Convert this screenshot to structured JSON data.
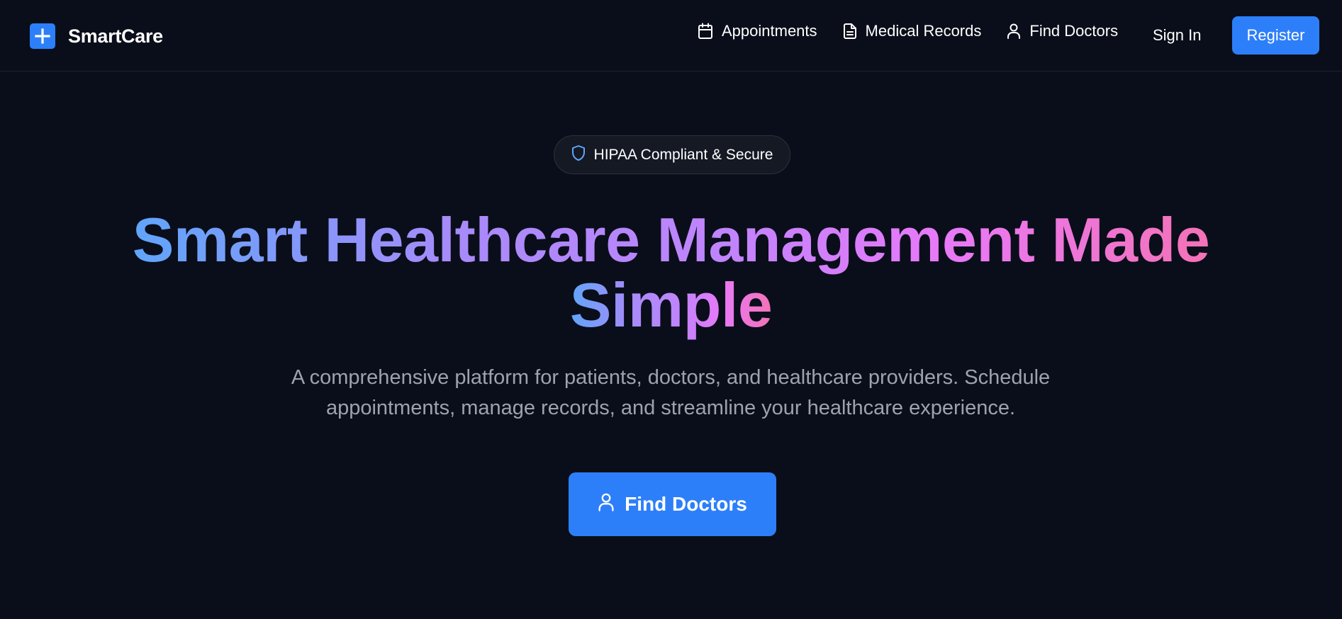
{
  "brand": {
    "name": "SmartCare",
    "logo_icon": "plus-icon",
    "accent_color": "#2d7ff9"
  },
  "nav": {
    "items": [
      {
        "label": "Appointments",
        "icon": "calendar-icon"
      },
      {
        "label": "Medical Records",
        "icon": "document-icon"
      },
      {
        "label": "Find Doctors",
        "icon": "user-icon"
      }
    ],
    "sign_in": "Sign In",
    "register": "Register"
  },
  "hero": {
    "badge": {
      "label": "HIPAA Compliant & Secure",
      "icon": "shield-icon"
    },
    "title_line1": "Smart Healthcare Management Made",
    "title_line2": "Simple",
    "subtitle_line1": "A comprehensive platform for patients, doctors, and healthcare providers. Schedule",
    "subtitle_line2": "appointments, manage records, and streamline your healthcare experience.",
    "cta": {
      "label": "Find Doctors",
      "icon": "user-icon"
    }
  },
  "colors": {
    "background": "#0a0e1a",
    "primary": "#2d7ff9",
    "muted_text": "#9ca3af",
    "gradient": [
      "#60a5fa",
      "#a78bfa",
      "#c084fc",
      "#e879f9",
      "#f472b6"
    ]
  }
}
